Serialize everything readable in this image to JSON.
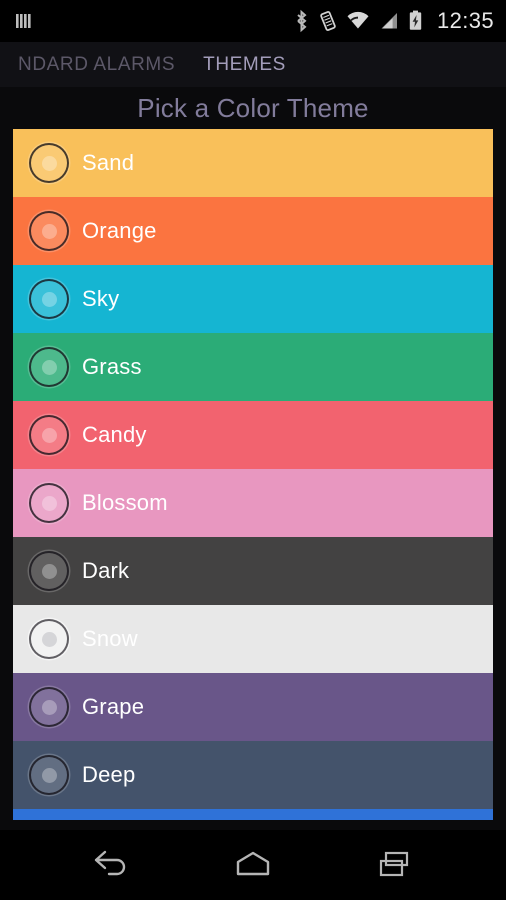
{
  "status_bar": {
    "icons": [
      {
        "name": "notification-bars-icon",
        "label": "notifications"
      },
      {
        "name": "bluetooth-icon",
        "label": "bluetooth"
      },
      {
        "name": "vibrate-icon",
        "label": "vibrate"
      },
      {
        "name": "wifi-icon",
        "label": "wifi"
      },
      {
        "name": "cell-signal-icon",
        "label": "cellular signal"
      },
      {
        "name": "battery-charging-icon",
        "label": "battery charging"
      }
    ],
    "time": "12:35"
  },
  "tabs": [
    {
      "label": "NDARD ALARMS",
      "active": false
    },
    {
      "label": "THEMES",
      "active": true
    }
  ],
  "page": {
    "title": "Pick a Color Theme",
    "title_color": "#827c9b"
  },
  "themes": [
    {
      "label": "Sand",
      "color": "#f9c05a",
      "selected": false
    },
    {
      "label": "Orange",
      "color": "#fb7440",
      "selected": false
    },
    {
      "label": "Sky",
      "color": "#15b5d2",
      "selected": false
    },
    {
      "label": "Grass",
      "color": "#2bac77",
      "selected": false
    },
    {
      "label": "Candy",
      "color": "#f2636f",
      "selected": false
    },
    {
      "label": "Blossom",
      "color": "#e897c0",
      "selected": false
    },
    {
      "label": "Dark",
      "color": "#434242",
      "selected": false
    },
    {
      "label": "Snow",
      "color": "#e8e8e8",
      "selected": false
    },
    {
      "label": "Grape",
      "color": "#695689",
      "selected": false
    },
    {
      "label": "Deep",
      "color": "#44536b",
      "selected": false
    }
  ],
  "scroll_indicator": {
    "color": "#2f72d8",
    "name": "scroll-position-bar"
  },
  "nav_bar": {
    "buttons": [
      {
        "name": "back-button",
        "label": "Back"
      },
      {
        "name": "home-button",
        "label": "Home"
      },
      {
        "name": "recents-button",
        "label": "Recent apps"
      }
    ]
  }
}
